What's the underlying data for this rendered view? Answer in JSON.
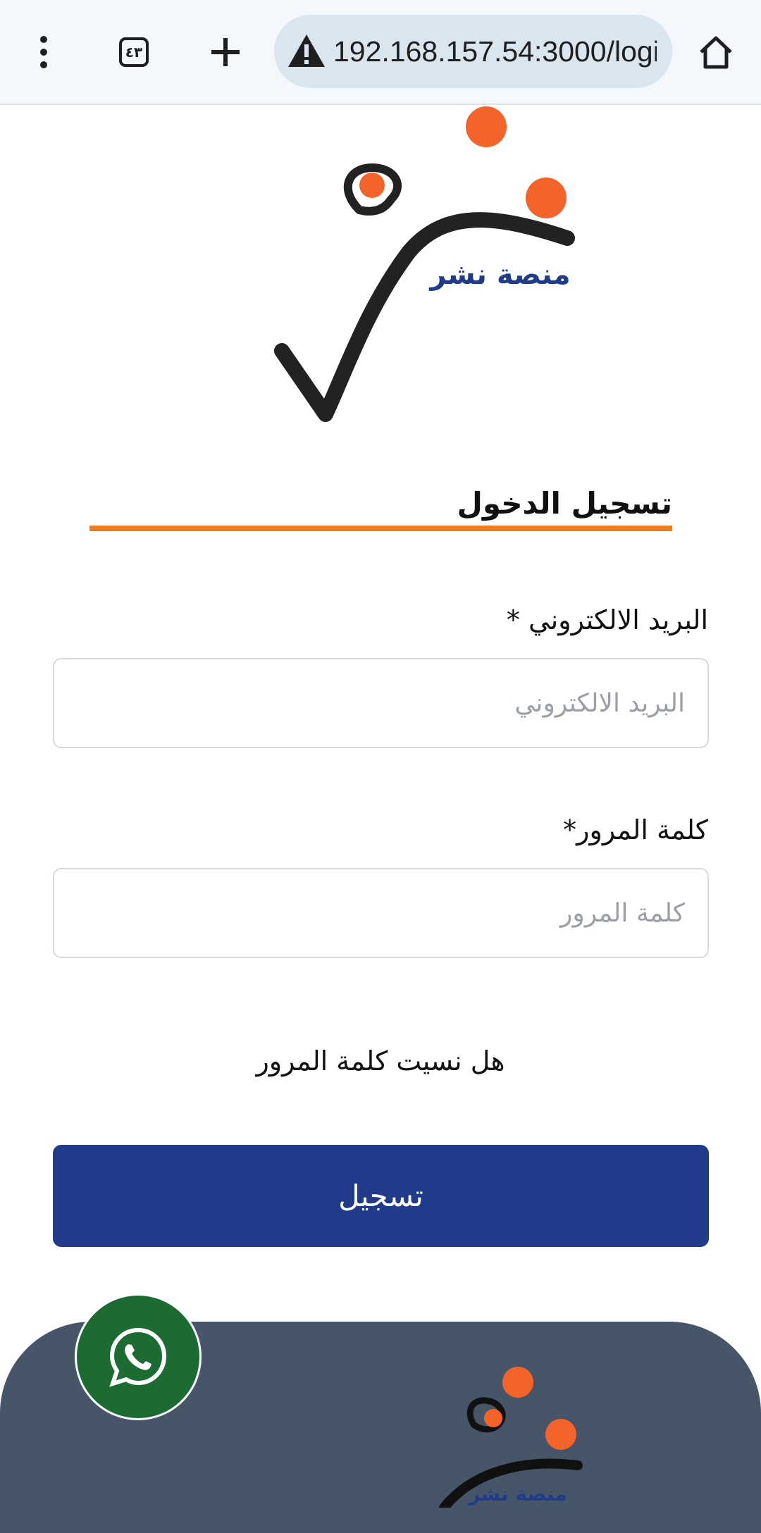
{
  "browser": {
    "url": "192.168.157.54:3000/logi",
    "tab_count": "٤٣",
    "icons": [
      "more-vert-icon",
      "tabs-icon",
      "plus-icon",
      "warning-icon",
      "home-icon"
    ]
  },
  "logo": {
    "text": "منصة نشر",
    "colors": {
      "accent": "#f4632a",
      "stroke": "#222222",
      "text": "#1f3b8a"
    }
  },
  "login": {
    "title": "تسجيل الدخول",
    "underline_color": "#f07b1e",
    "email_label": "البريد الالكتروني *",
    "email_placeholder": "البريد الالكتروني",
    "email_value": "",
    "password_label": "كلمة المرور*",
    "password_placeholder": "كلمة المرور",
    "password_value": "",
    "forgot_label": "هل نسيت كلمة المرور",
    "submit_label": "تسجيل",
    "submit_color": "#1f3b8a"
  },
  "footer": {
    "background": "#475569",
    "logo_text": "منصة نشر",
    "whatsapp_icon": "whatsapp-icon",
    "whatsapp_color": "#1b6b33"
  }
}
